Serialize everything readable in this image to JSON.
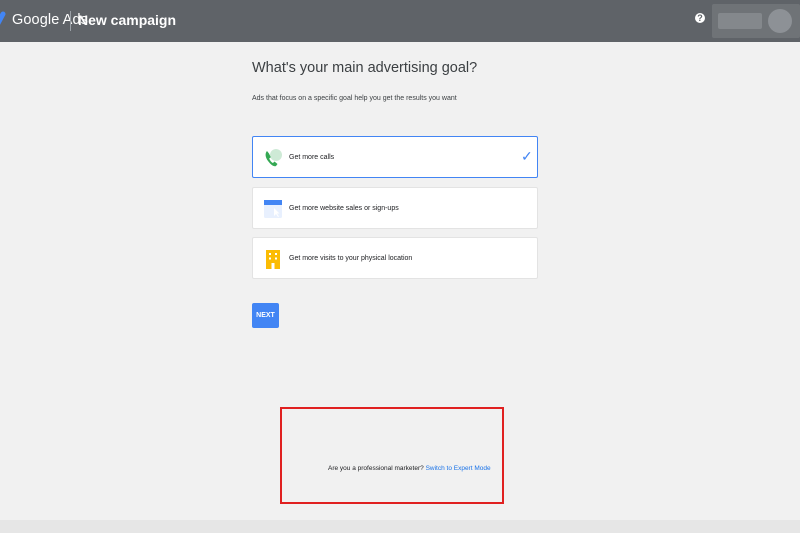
{
  "topbar": {
    "brand": "Google Ads",
    "page_title": "New campaign",
    "help_label": "?"
  },
  "main": {
    "heading": "What's your main advertising goal?",
    "subheading": "Ads that focus on a specific goal help you get the results you want",
    "options": [
      {
        "label": "Get more calls",
        "icon": "phone-icon",
        "selected": true
      },
      {
        "label": "Get more website sales or sign-ups",
        "icon": "browser-window-icon",
        "selected": false
      },
      {
        "label": "Get more visits to your physical location",
        "icon": "building-icon",
        "selected": false
      }
    ],
    "next_label": "NEXT"
  },
  "footer": {
    "question": "Are you a professional marketer? ",
    "link": "Switch to Expert Mode"
  },
  "colors": {
    "topbar": "#5f6368",
    "accent": "#4285f4",
    "highlight": "#e02020",
    "background": "#f1f1f1"
  }
}
